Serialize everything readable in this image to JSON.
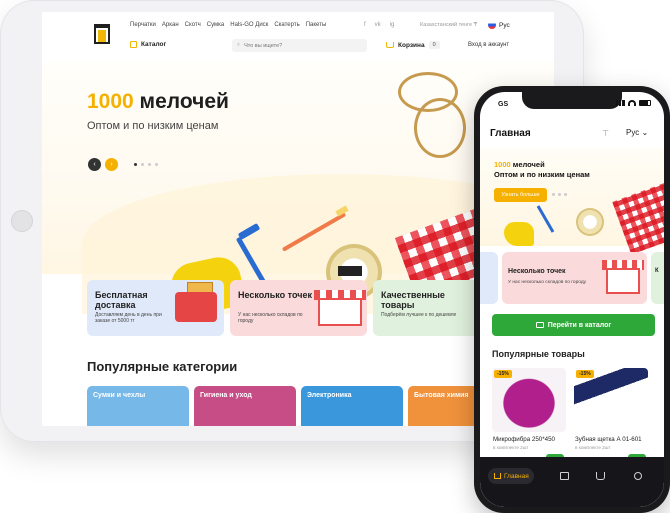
{
  "tablet": {
    "nav_categories": [
      "Перчатки",
      "Аркан",
      "Скотч",
      "Сумка",
      "Hals-GO Диск",
      "Скатерть",
      "Пакеты"
    ],
    "socials": [
      "f",
      "vk",
      "ig"
    ],
    "region": "Казахстанский тенге ₸",
    "language": "Рус",
    "catalog_label": "Каталог",
    "search_placeholder": "Что вы ищете?",
    "cart_label": "Корзина",
    "cart_count": "0",
    "login_label": "Вход в аккаунт",
    "hero": {
      "title_accent": "1000",
      "title_rest": " мелочей",
      "subtitle": "Оптом и по низким ценам",
      "prev_icon": "‹",
      "next_icon": "›"
    },
    "features": [
      {
        "title": "Бесплатная доставка",
        "desc": "Доставляем день в день при заказе от 5000 тг"
      },
      {
        "title": "Несколько точек",
        "desc": "У нас несколько складов по городу"
      },
      {
        "title": "Качественные товары",
        "desc": "Подберём лучшее к по дешевле"
      }
    ],
    "popular_heading": "Популярные категории",
    "popular_categories": [
      "Сумки и чехлы",
      "Гигиена и уход",
      "Электроника",
      "Бытовая химия"
    ]
  },
  "phone": {
    "time": "GS",
    "title": "Главная",
    "filter_icon": "⊤",
    "language": "Рус",
    "hero": {
      "title_accent": "1000",
      "title_rest": " мелочей",
      "subtitle": "Оптом и по низким ценам",
      "cta": "Узнать больше"
    },
    "card": {
      "title": "Несколько точек",
      "desc": "У нас несколько складов по городу"
    },
    "card_right_title": "К",
    "catalog_button": "Перейти в каталог",
    "popular_heading": "Популярные товары",
    "products": [
      {
        "badge": "-15%",
        "name": "Микрофибра 250*450",
        "meta": "в комплекте 2шт"
      },
      {
        "badge": "-15%",
        "name": "Зубная щетка А 01-601",
        "meta": "в комплекте 2шт"
      }
    ],
    "tabs": {
      "home": "Главная"
    }
  },
  "colors": {
    "accent": "#f5b000",
    "green": "#2fa83a",
    "brand_dark": "#1a1a1c"
  }
}
